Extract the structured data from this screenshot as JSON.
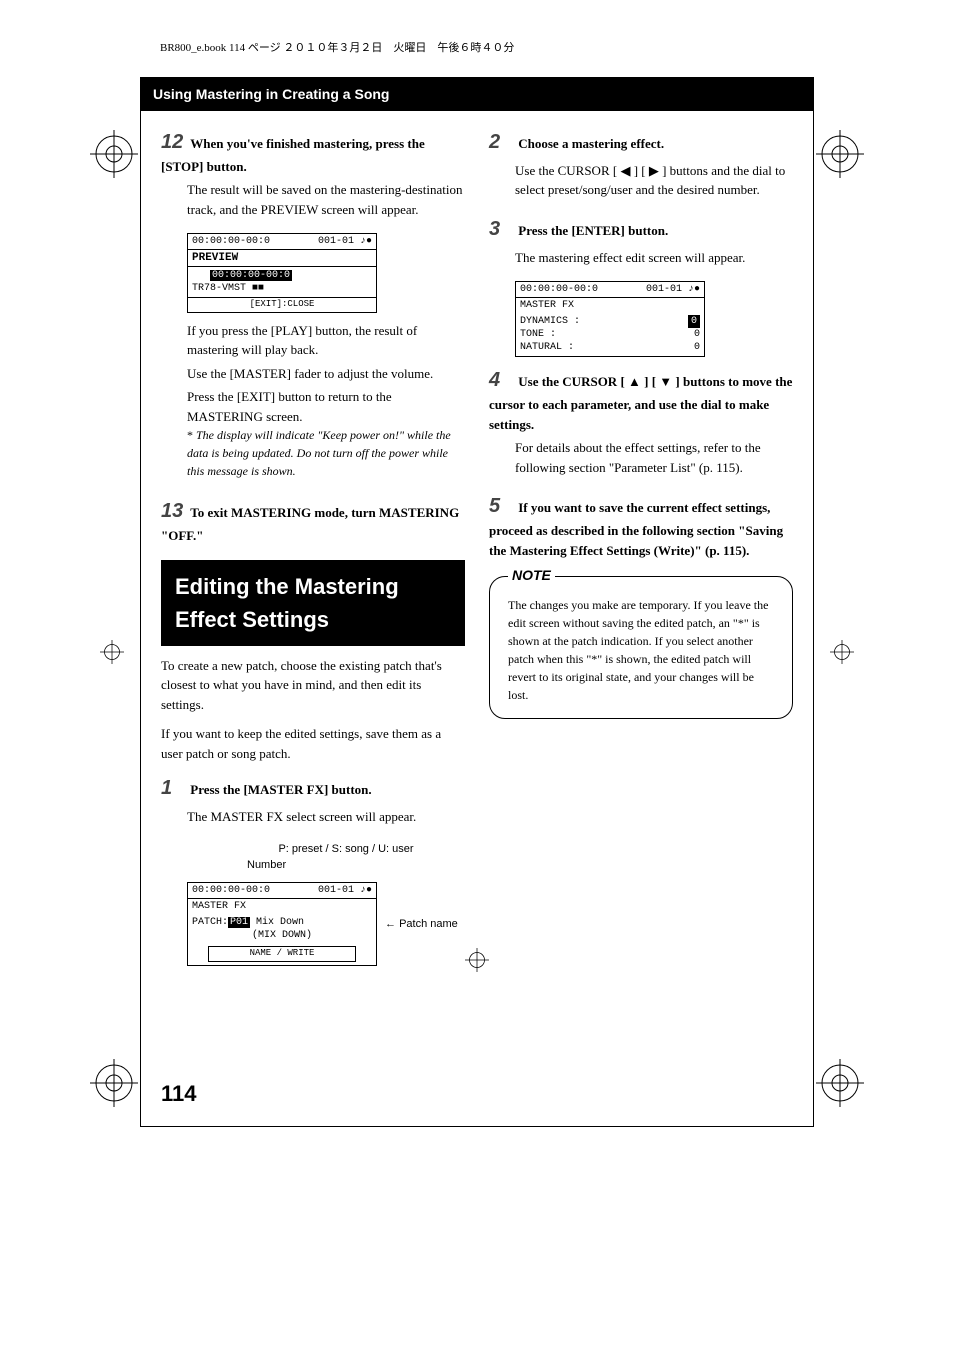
{
  "print_header": "BR800_e.book  114 ページ  ２０１０年３月２日　火曜日　午後６時４０分",
  "section_header": "Using Mastering in Creating a Song",
  "left_col": {
    "step12_num": "12",
    "step12_title": "When you've finished mastering, press the [STOP] button.",
    "step12_body1": "The result will be saved on the mastering-destination track, and the PREVIEW screen will appear.",
    "screen1_top_left": "00:00:00-00:0",
    "screen1_top_right": "001-01 ♪●",
    "screen1_title": "PREVIEW",
    "screen1_line1": "00:00:00-00:0",
    "screen1_line2": "TR78-VMST ■■",
    "screen1_footer": "[EXIT]:CLOSE",
    "step12_body2": "If you press the [PLAY] button, the result of mastering will play back.",
    "step12_body3": "Use the [MASTER] fader to adjust the volume.",
    "step12_body4": "Press the [EXIT] button to return to the MASTERING screen.",
    "step12_note": "The display will indicate \"Keep power on!\" while the data is being updated. Do not turn off the power while this message is shown.",
    "step13_num": "13",
    "step13_title": "To exit MASTERING mode, turn MASTERING \"OFF.\"",
    "section_title": "Editing the Mastering Effect Settings",
    "intro1": "To create a new patch, choose the existing patch that's closest to what you have in mind, and then edit its settings.",
    "intro2": "If you want to keep the edited settings, save them as a user patch or song patch.",
    "step1_num": "1",
    "step1_title": "Press the [MASTER FX] button.",
    "step1_body": "The MASTER FX select screen will appear.",
    "ann_preset": "P: preset / S: song / U: user",
    "ann_number": "Number",
    "ann_patch_name": "Patch name",
    "screen2_top_left": "00:00:00-00:0",
    "screen2_top_right": "001-01 ♪●",
    "screen2_title": "MASTER FX",
    "screen2_patch_label": "PATCH:",
    "screen2_patch_num": "P01",
    "screen2_patch_name": "Mix Down",
    "screen2_patch_sub": "(MIX DOWN)",
    "screen2_footer": "NAME / WRITE"
  },
  "right_col": {
    "step2_num": "2",
    "step2_title": "Choose a mastering effect.",
    "step2_body": "Use the CURSOR [ ◀ ] [ ▶ ] buttons and the dial to select preset/song/user and the desired number.",
    "step3_num": "3",
    "step3_title": "Press the [ENTER] button.",
    "step3_body": "The mastering effect edit screen will appear.",
    "screen3_top_left": "00:00:00-00:0",
    "screen3_top_right": "001-01 ♪●",
    "screen3_title": "MASTER FX",
    "screen3_param1_name": "DYNAMICS :",
    "screen3_param1_val": "0",
    "screen3_param2_name": "TONE     :",
    "screen3_param2_val": "0",
    "screen3_param3_name": "NATURAL  :",
    "screen3_param3_val": "0",
    "step4_num": "4",
    "step4_title": "Use the CURSOR [ ▲ ] [ ▼ ] buttons to move the cursor to each parameter, and use the dial to make settings.",
    "step4_body": "For details about the effect settings, refer to the following section \"Parameter List\" (p. 115).",
    "step5_num": "5",
    "step5_title": "If you want to save the current effect settings, proceed as described in the following section \"Saving the Mastering Effect Settings (Write)\" (p. 115).",
    "note_label": "NOTE",
    "note_body": "The changes you make are temporary. If you leave the edit screen without saving the edited patch, an \"*\" is shown at the patch indication. If you select another patch when this \"*\" is shown, the edited patch will revert to its original state, and your changes will be lost."
  },
  "page_number": "114"
}
